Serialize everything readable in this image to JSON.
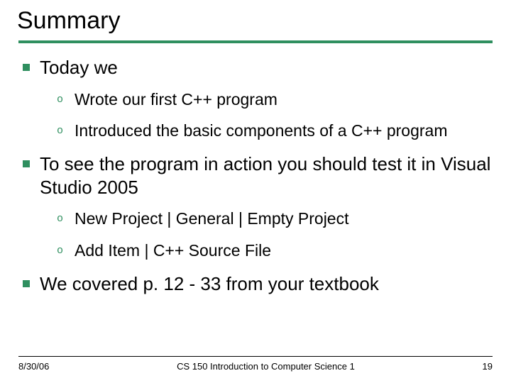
{
  "title": "Summary",
  "bullets": [
    {
      "text": "Today we",
      "children": [
        "Wrote our first C++ program",
        "Introduced the basic components of a C++ program"
      ]
    },
    {
      "text": "To see the program in action you should test it in Visual Studio 2005",
      "children": [
        "New Project | General | Empty Project",
        "Add Item | C++ Source File"
      ]
    },
    {
      "text": "We covered p. 12 - 33 from your textbook",
      "children": []
    }
  ],
  "footer": {
    "date": "8/30/06",
    "course": "CS 150 Introduction to Computer Science 1",
    "page": "19"
  }
}
